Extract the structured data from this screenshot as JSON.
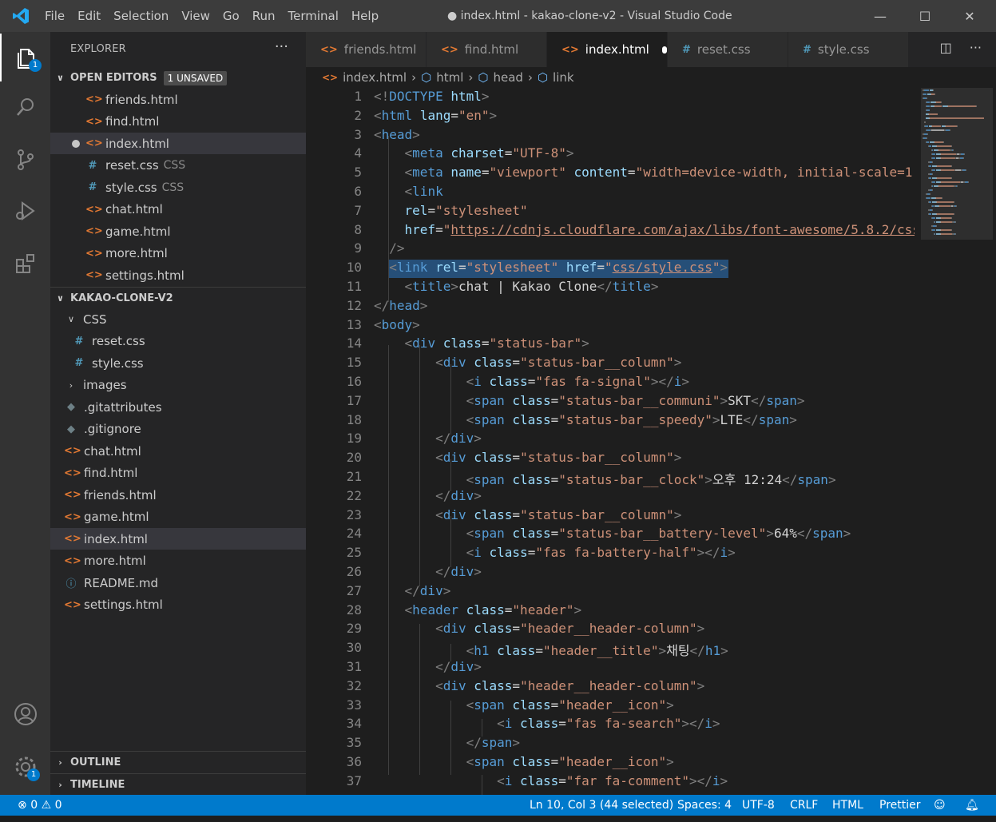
{
  "titlebar": {
    "menu": [
      "File",
      "Edit",
      "Selection",
      "View",
      "Go",
      "Run",
      "Terminal",
      "Help"
    ],
    "title": "● index.html - kakao-clone-v2 - Visual Studio Code",
    "minimize": "—",
    "maximize": "☐",
    "close": "✕"
  },
  "activity": {
    "explorer_badge": "1",
    "settings_badge": "1"
  },
  "sidebar": {
    "title": "EXPLORER",
    "more": "···",
    "open_editors": {
      "label": "OPEN EDITORS",
      "badge": "1 UNSAVED",
      "items": [
        {
          "name": "friends.html",
          "icon": "html",
          "desc": ""
        },
        {
          "name": "find.html",
          "icon": "html",
          "desc": ""
        },
        {
          "name": "index.html",
          "icon": "html",
          "desc": ""
        },
        {
          "name": "reset.css",
          "icon": "css",
          "desc": "CSS"
        },
        {
          "name": "style.css",
          "icon": "css",
          "desc": "CSS"
        },
        {
          "name": "chat.html",
          "icon": "html",
          "desc": ""
        },
        {
          "name": "game.html",
          "icon": "html",
          "desc": ""
        },
        {
          "name": "more.html",
          "icon": "html",
          "desc": ""
        },
        {
          "name": "settings.html",
          "icon": "html",
          "desc": ""
        }
      ]
    },
    "project": {
      "label": "KAKAO-CLONE-V2",
      "items": [
        {
          "name": "CSS",
          "type": "folder-open"
        },
        {
          "name": "reset.css",
          "type": "css"
        },
        {
          "name": "style.css",
          "type": "css"
        },
        {
          "name": "images",
          "type": "folder"
        },
        {
          "name": ".gitattributes",
          "type": "git"
        },
        {
          "name": ".gitignore",
          "type": "git"
        },
        {
          "name": "chat.html",
          "type": "html"
        },
        {
          "name": "find.html",
          "type": "html"
        },
        {
          "name": "friends.html",
          "type": "html"
        },
        {
          "name": "game.html",
          "type": "html"
        },
        {
          "name": "index.html",
          "type": "html"
        },
        {
          "name": "more.html",
          "type": "html"
        },
        {
          "name": "README.md",
          "type": "info"
        },
        {
          "name": "settings.html",
          "type": "html"
        }
      ]
    },
    "outline": "OUTLINE",
    "timeline": "TIMELINE"
  },
  "tabs": [
    {
      "name": "friends.html",
      "icon": "html"
    },
    {
      "name": "find.html",
      "icon": "html"
    },
    {
      "name": "index.html",
      "icon": "html"
    },
    {
      "name": "reset.css",
      "icon": "css"
    },
    {
      "name": "style.css",
      "icon": "css"
    }
  ],
  "icons": {
    "html": "<>",
    "css": "#",
    "git": "◆",
    "info": "ⓘ",
    "folder_open": "∨",
    "folder": "›"
  },
  "breadcrumb": [
    "index.html",
    "html",
    "head",
    "link"
  ],
  "editor": {
    "lines": [
      [
        [
          "t",
          "<!"
        ],
        [
          "n",
          "DOCTYPE"
        ],
        [
          "x",
          " "
        ],
        [
          "a",
          "html"
        ],
        [
          "t",
          ">"
        ]
      ],
      [
        [
          "t",
          "<"
        ],
        [
          "n",
          "html"
        ],
        [
          "x",
          " "
        ],
        [
          "a",
          "lang"
        ],
        [
          "x",
          "="
        ],
        [
          "s",
          "\"en\""
        ],
        [
          "t",
          ">"
        ]
      ],
      [
        [
          "t",
          "<"
        ],
        [
          "n",
          "head"
        ],
        [
          "t",
          ">"
        ]
      ],
      [
        [
          "x",
          "    "
        ],
        [
          "t",
          "<"
        ],
        [
          "n",
          "meta"
        ],
        [
          "x",
          " "
        ],
        [
          "a",
          "charset"
        ],
        [
          "x",
          "="
        ],
        [
          "s",
          "\"UTF-8\""
        ],
        [
          "t",
          ">"
        ]
      ],
      [
        [
          "x",
          "    "
        ],
        [
          "t",
          "<"
        ],
        [
          "n",
          "meta"
        ],
        [
          "x",
          " "
        ],
        [
          "a",
          "name"
        ],
        [
          "x",
          "="
        ],
        [
          "s",
          "\"viewport\""
        ],
        [
          "x",
          " "
        ],
        [
          "a",
          "content"
        ],
        [
          "x",
          "="
        ],
        [
          "s",
          "\"width=device-width, initial-scale=1.0\""
        ],
        [
          "t",
          ">"
        ]
      ],
      [
        [
          "x",
          "    "
        ],
        [
          "t",
          "<"
        ],
        [
          "n",
          "link"
        ]
      ],
      [
        [
          "x",
          "    "
        ],
        [
          "a",
          "rel"
        ],
        [
          "x",
          "="
        ],
        [
          "s",
          "\"stylesheet\""
        ]
      ],
      [
        [
          "x",
          "    "
        ],
        [
          "a",
          "href"
        ],
        [
          "x",
          "="
        ],
        [
          "s",
          "\""
        ],
        [
          "su",
          "https://cdnjs.cloudflare.com/ajax/libs/font-awesome/5.8.2/css/all.min.css"
        ],
        [
          "s",
          "\""
        ]
      ],
      [
        [
          "x",
          "  "
        ],
        [
          "t",
          "/>"
        ]
      ],
      [
        [
          "x",
          "  "
        ],
        [
          "t",
          "<"
        ],
        [
          "n",
          "link"
        ],
        [
          "x",
          " "
        ],
        [
          "a",
          "rel"
        ],
        [
          "x",
          "="
        ],
        [
          "s",
          "\"stylesheet\""
        ],
        [
          "x",
          " "
        ],
        [
          "a",
          "href"
        ],
        [
          "x",
          "="
        ],
        [
          "s",
          "\""
        ],
        [
          "su",
          "css/style.css"
        ],
        [
          "s",
          "\""
        ],
        [
          "t",
          ">"
        ]
      ],
      [
        [
          "x",
          "    "
        ],
        [
          "t",
          "<"
        ],
        [
          "n",
          "title"
        ],
        [
          "t",
          ">"
        ],
        [
          "x",
          "chat | Kakao Clone"
        ],
        [
          "t",
          "</"
        ],
        [
          "n",
          "title"
        ],
        [
          "t",
          ">"
        ]
      ],
      [
        [
          "t",
          "</"
        ],
        [
          "n",
          "head"
        ],
        [
          "t",
          ">"
        ]
      ],
      [
        [
          "t",
          "<"
        ],
        [
          "n",
          "body"
        ],
        [
          "t",
          ">"
        ]
      ],
      [
        [
          "x",
          "    "
        ],
        [
          "t",
          "<"
        ],
        [
          "n",
          "div"
        ],
        [
          "x",
          " "
        ],
        [
          "a",
          "class"
        ],
        [
          "x",
          "="
        ],
        [
          "s",
          "\"status-bar\""
        ],
        [
          "t",
          ">"
        ]
      ],
      [
        [
          "x",
          "        "
        ],
        [
          "t",
          "<"
        ],
        [
          "n",
          "div"
        ],
        [
          "x",
          " "
        ],
        [
          "a",
          "class"
        ],
        [
          "x",
          "="
        ],
        [
          "s",
          "\"status-bar__column\""
        ],
        [
          "t",
          ">"
        ]
      ],
      [
        [
          "x",
          "            "
        ],
        [
          "t",
          "<"
        ],
        [
          "n",
          "i"
        ],
        [
          "x",
          " "
        ],
        [
          "a",
          "class"
        ],
        [
          "x",
          "="
        ],
        [
          "s",
          "\"fas fa-signal\""
        ],
        [
          "t",
          "></"
        ],
        [
          "n",
          "i"
        ],
        [
          "t",
          ">"
        ]
      ],
      [
        [
          "x",
          "            "
        ],
        [
          "t",
          "<"
        ],
        [
          "n",
          "span"
        ],
        [
          "x",
          " "
        ],
        [
          "a",
          "class"
        ],
        [
          "x",
          "="
        ],
        [
          "s",
          "\"status-bar__communi\""
        ],
        [
          "t",
          ">"
        ],
        [
          "x",
          "SKT"
        ],
        [
          "t",
          "</"
        ],
        [
          "n",
          "span"
        ],
        [
          "t",
          ">"
        ]
      ],
      [
        [
          "x",
          "            "
        ],
        [
          "t",
          "<"
        ],
        [
          "n",
          "span"
        ],
        [
          "x",
          " "
        ],
        [
          "a",
          "class"
        ],
        [
          "x",
          "="
        ],
        [
          "s",
          "\"status-bar__speedy\""
        ],
        [
          "t",
          ">"
        ],
        [
          "x",
          "LTE"
        ],
        [
          "t",
          "</"
        ],
        [
          "n",
          "span"
        ],
        [
          "t",
          ">"
        ]
      ],
      [
        [
          "x",
          "        "
        ],
        [
          "t",
          "</"
        ],
        [
          "n",
          "div"
        ],
        [
          "t",
          ">"
        ]
      ],
      [
        [
          "x",
          "        "
        ],
        [
          "t",
          "<"
        ],
        [
          "n",
          "div"
        ],
        [
          "x",
          " "
        ],
        [
          "a",
          "class"
        ],
        [
          "x",
          "="
        ],
        [
          "s",
          "\"status-bar__column\""
        ],
        [
          "t",
          ">"
        ]
      ],
      [
        [
          "x",
          "            "
        ],
        [
          "t",
          "<"
        ],
        [
          "n",
          "span"
        ],
        [
          "x",
          " "
        ],
        [
          "a",
          "class"
        ],
        [
          "x",
          "="
        ],
        [
          "s",
          "\"status-bar__clock\""
        ],
        [
          "t",
          ">"
        ],
        [
          "x",
          "오후 12:24"
        ],
        [
          "t",
          "</"
        ],
        [
          "n",
          "span"
        ],
        [
          "t",
          ">"
        ]
      ],
      [
        [
          "x",
          "        "
        ],
        [
          "t",
          "</"
        ],
        [
          "n",
          "div"
        ],
        [
          "t",
          ">"
        ]
      ],
      [
        [
          "x",
          "        "
        ],
        [
          "t",
          "<"
        ],
        [
          "n",
          "div"
        ],
        [
          "x",
          " "
        ],
        [
          "a",
          "class"
        ],
        [
          "x",
          "="
        ],
        [
          "s",
          "\"status-bar__column\""
        ],
        [
          "t",
          ">"
        ]
      ],
      [
        [
          "x",
          "            "
        ],
        [
          "t",
          "<"
        ],
        [
          "n",
          "span"
        ],
        [
          "x",
          " "
        ],
        [
          "a",
          "class"
        ],
        [
          "x",
          "="
        ],
        [
          "s",
          "\"status-bar__battery-level\""
        ],
        [
          "t",
          ">"
        ],
        [
          "x",
          "64%"
        ],
        [
          "t",
          "</"
        ],
        [
          "n",
          "span"
        ],
        [
          "t",
          ">"
        ]
      ],
      [
        [
          "x",
          "            "
        ],
        [
          "t",
          "<"
        ],
        [
          "n",
          "i"
        ],
        [
          "x",
          " "
        ],
        [
          "a",
          "class"
        ],
        [
          "x",
          "="
        ],
        [
          "s",
          "\"fas fa-battery-half\""
        ],
        [
          "t",
          "></"
        ],
        [
          "n",
          "i"
        ],
        [
          "t",
          ">"
        ]
      ],
      [
        [
          "x",
          "        "
        ],
        [
          "t",
          "</"
        ],
        [
          "n",
          "div"
        ],
        [
          "t",
          ">"
        ]
      ],
      [
        [
          "x",
          "    "
        ],
        [
          "t",
          "</"
        ],
        [
          "n",
          "div"
        ],
        [
          "t",
          ">"
        ]
      ],
      [
        [
          "x",
          "    "
        ],
        [
          "t",
          "<"
        ],
        [
          "n",
          "header"
        ],
        [
          "x",
          " "
        ],
        [
          "a",
          "class"
        ],
        [
          "x",
          "="
        ],
        [
          "s",
          "\"header\""
        ],
        [
          "t",
          ">"
        ]
      ],
      [
        [
          "x",
          "        "
        ],
        [
          "t",
          "<"
        ],
        [
          "n",
          "div"
        ],
        [
          "x",
          " "
        ],
        [
          "a",
          "class"
        ],
        [
          "x",
          "="
        ],
        [
          "s",
          "\"header__header-column\""
        ],
        [
          "t",
          ">"
        ]
      ],
      [
        [
          "x",
          "            "
        ],
        [
          "t",
          "<"
        ],
        [
          "n",
          "h1"
        ],
        [
          "x",
          " "
        ],
        [
          "a",
          "class"
        ],
        [
          "x",
          "="
        ],
        [
          "s",
          "\"header__title\""
        ],
        [
          "t",
          ">"
        ],
        [
          "x",
          "채팅"
        ],
        [
          "t",
          "</"
        ],
        [
          "n",
          "h1"
        ],
        [
          "t",
          ">"
        ]
      ],
      [
        [
          "x",
          "        "
        ],
        [
          "t",
          "</"
        ],
        [
          "n",
          "div"
        ],
        [
          "t",
          ">"
        ]
      ],
      [
        [
          "x",
          "        "
        ],
        [
          "t",
          "<"
        ],
        [
          "n",
          "div"
        ],
        [
          "x",
          " "
        ],
        [
          "a",
          "class"
        ],
        [
          "x",
          "="
        ],
        [
          "s",
          "\"header__header-column\""
        ],
        [
          "t",
          ">"
        ]
      ],
      [
        [
          "x",
          "            "
        ],
        [
          "t",
          "<"
        ],
        [
          "n",
          "span"
        ],
        [
          "x",
          " "
        ],
        [
          "a",
          "class"
        ],
        [
          "x",
          "="
        ],
        [
          "s",
          "\"header__icon\""
        ],
        [
          "t",
          ">"
        ]
      ],
      [
        [
          "x",
          "                "
        ],
        [
          "t",
          "<"
        ],
        [
          "n",
          "i"
        ],
        [
          "x",
          " "
        ],
        [
          "a",
          "class"
        ],
        [
          "x",
          "="
        ],
        [
          "s",
          "\"fas fa-search\""
        ],
        [
          "t",
          "></"
        ],
        [
          "n",
          "i"
        ],
        [
          "t",
          ">"
        ]
      ],
      [
        [
          "x",
          "            "
        ],
        [
          "t",
          "</"
        ],
        [
          "n",
          "span"
        ],
        [
          "t",
          ">"
        ]
      ],
      [
        [
          "x",
          "            "
        ],
        [
          "t",
          "<"
        ],
        [
          "n",
          "span"
        ],
        [
          "x",
          " "
        ],
        [
          "a",
          "class"
        ],
        [
          "x",
          "="
        ],
        [
          "s",
          "\"header__icon\""
        ],
        [
          "t",
          ">"
        ]
      ],
      [
        [
          "x",
          "                "
        ],
        [
          "t",
          "<"
        ],
        [
          "n",
          "i"
        ],
        [
          "x",
          " "
        ],
        [
          "a",
          "class"
        ],
        [
          "x",
          "="
        ],
        [
          "s",
          "\"far fa-comment\""
        ],
        [
          "t",
          "></"
        ],
        [
          "n",
          "i"
        ],
        [
          "t",
          ">"
        ]
      ]
    ]
  },
  "statusbar": {
    "errors": "0",
    "warnings": "0",
    "position": "Ln 10, Col 3 (44 selected)",
    "spaces": "Spaces: 4",
    "encoding": "UTF-8",
    "eol": "CRLF",
    "language": "HTML",
    "formatter": "Prettier"
  },
  "colors": {
    "accent": "#007acc",
    "html_icon": "#e37933",
    "css_icon": "#519aba"
  }
}
